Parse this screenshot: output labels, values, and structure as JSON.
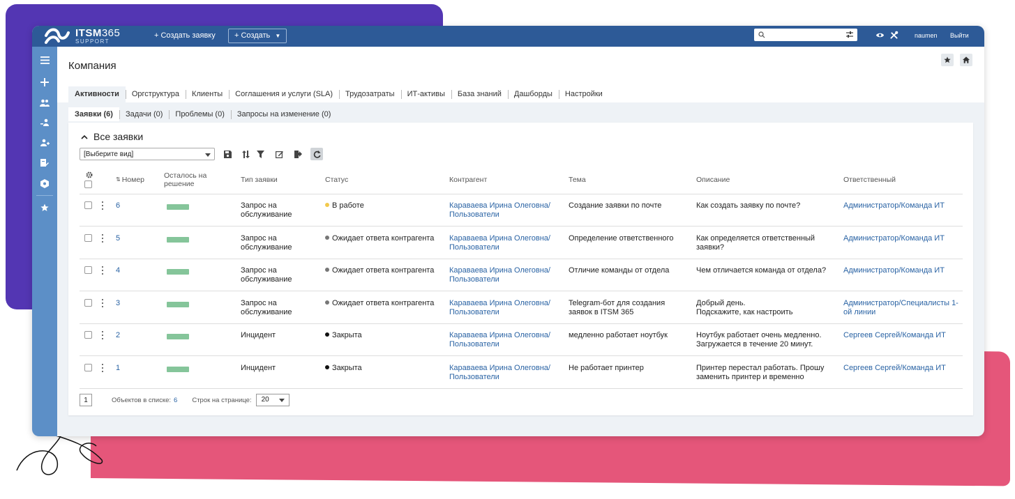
{
  "app": {
    "logo_title": "ITSM",
    "logo_version": "365",
    "logo_sub": "SUPPORT"
  },
  "topbar": {
    "create_request_link": "+ Создать заявку",
    "create_button": "+ Создать",
    "search": {
      "value": "",
      "placeholder": ""
    },
    "username": "naumen",
    "logout": "Выйти"
  },
  "sidebar": {
    "items": [
      "menu-icon",
      "plus-icon",
      "users-icon",
      "user-tree-icon",
      "user-add-icon",
      "report-edit-icon",
      "settings-hex-icon",
      "star-icon"
    ]
  },
  "page": {
    "title": "Компания"
  },
  "tabs": [
    "Активности",
    "Оргструктура",
    "Клиенты",
    "Соглашения и услуги (SLA)",
    "Трудозатраты",
    "ИТ-активы",
    "База знаний",
    "Дашборды",
    "Настройки"
  ],
  "active_tab": "Активности",
  "subtabs": [
    "Заявки (6)",
    "Задачи (0)",
    "Проблемы (0)",
    "Запросы на изменение (0)"
  ],
  "active_subtab": "Заявки (6)",
  "list": {
    "title": "Все заявки",
    "view_select": "[Выберите вид]"
  },
  "columns": {
    "number": "Номер",
    "remaining": "Осталось на решение",
    "type": "Тип заявки",
    "status": "Статус",
    "counterparty": "Контрагент",
    "topic": "Тема",
    "description": "Описание",
    "responsible": "Ответственный"
  },
  "colors": {
    "topbar": "#2d5a97",
    "sidebar": "#5c8fc7",
    "link": "#2a63a4",
    "sla_bar": "#85c59a",
    "status_in_progress": "#f2c94c",
    "status_waiting": "#777777",
    "status_closed": "#111111"
  },
  "rows": [
    {
      "num": "6",
      "sla_fraction": 1.0,
      "type": "Запрос на обслуживание",
      "status": "В работе",
      "status_color": "#f2c94c",
      "counterparty": "Караваева Ирина Олеговна/ Пользователи",
      "topic": "Создание заявки по почте",
      "description": "Как создать заявку по почте?",
      "responsible": "Администратор/Команда ИТ"
    },
    {
      "num": "5",
      "sla_fraction": 1.0,
      "type": "Запрос на обслуживание",
      "status": "Ожидает ответа контрагента",
      "status_color": "#777777",
      "counterparty": "Караваева Ирина Олеговна/ Пользователи",
      "topic": "Определение ответственного",
      "description": "Как определяется ответственный заявки?",
      "responsible": "Администратор/Команда ИТ"
    },
    {
      "num": "4",
      "sla_fraction": 1.0,
      "type": "Запрос на обслуживание",
      "status": "Ожидает ответа контрагента",
      "status_color": "#777777",
      "counterparty": "Караваева Ирина Олеговна/ Пользователи",
      "topic": "Отличие команды от отдела",
      "description": "Чем отличается команда от отдела?",
      "responsible": "Администратор/Команда ИТ"
    },
    {
      "num": "3",
      "sla_fraction": 1.0,
      "type": "Запрос на обслуживание",
      "status": "Ожидает ответа контрагента",
      "status_color": "#777777",
      "counterparty": "Караваева Ирина Олеговна/ Пользователи",
      "topic": "Telegram-бот для создания заявок в ITSM 365",
      "description": "Добрый день.\nПодскажите, как настроить",
      "responsible": "Администратор/Специалисты 1-ой линии"
    },
    {
      "num": "2",
      "sla_fraction": 1.0,
      "type": "Инцидент",
      "status": "Закрыта",
      "status_color": "#111111",
      "counterparty": "Караваева Ирина Олеговна/ Пользователи",
      "topic": "медленно работает ноутбук",
      "description": "Ноутбук работает очень медленно. Загружается в течение 20 минут.",
      "responsible": "Сергеев Сергей/Команда ИТ"
    },
    {
      "num": "1",
      "sla_fraction": 1.0,
      "type": "Инцидент",
      "status": "Закрыта",
      "status_color": "#111111",
      "counterparty": "Караваева Ирина Олеговна/ Пользователи",
      "topic": "Не работает принтер",
      "description": "Принтер перестал работать. Прошу заменить принтер и временно",
      "responsible": "Сергеев Сергей/Команда ИТ"
    }
  ],
  "footer": {
    "page": "1",
    "objects_label": "Объектов в списке:",
    "objects_count": "6",
    "rows_label": "Строк на странице:",
    "rows_value": "20"
  }
}
